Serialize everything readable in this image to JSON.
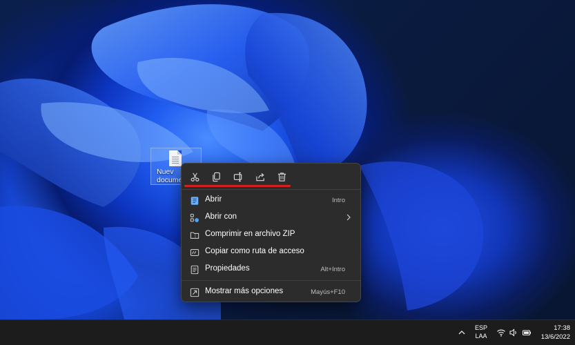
{
  "desktop": {
    "icon_label_line1": "Nuev",
    "icon_label_line2": "docume",
    "icon_name": "text-file-icon"
  },
  "context_menu": {
    "toolbar": [
      {
        "name": "cut",
        "icon": "scissors-icon"
      },
      {
        "name": "copy",
        "icon": "copy-icon"
      },
      {
        "name": "rename",
        "icon": "rename-icon"
      },
      {
        "name": "share",
        "icon": "share-icon"
      },
      {
        "name": "delete",
        "icon": "trash-icon"
      }
    ],
    "items": [
      {
        "label": "Abrir",
        "shortcut": "Intro",
        "icon": "open-document-icon"
      },
      {
        "label": "Abrir con",
        "shortcut": "",
        "icon": "open-with-icon",
        "submenu": true
      },
      {
        "label": "Comprimir en archivo ZIP",
        "shortcut": "",
        "icon": "zip-archive-icon"
      },
      {
        "label": "Copiar como ruta de acceso",
        "shortcut": "",
        "icon": "copy-path-icon"
      },
      {
        "label": "Propiedades",
        "shortcut": "Alt+Intro",
        "icon": "properties-icon"
      },
      {
        "label": "Mostrar más opciones",
        "shortcut": "Mayús+F10",
        "icon": "more-options-icon"
      }
    ],
    "highlight_color": "#d41f1f"
  },
  "taskbar": {
    "language_line1": "ESP",
    "language_line2": "LAA",
    "time": "17:38",
    "date": "13/6/2022",
    "tray_icons": [
      "chevron-up-icon",
      "wifi-icon",
      "volume-icon",
      "battery-icon"
    ]
  }
}
